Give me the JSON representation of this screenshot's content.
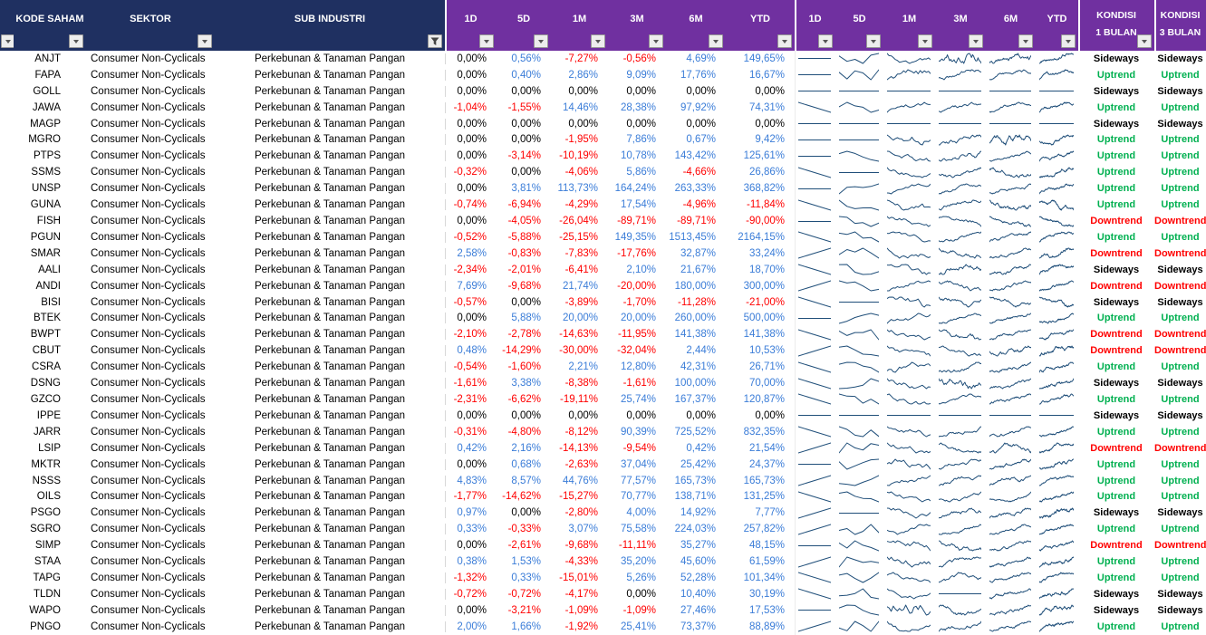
{
  "colors": {
    "header_navy": "#1F3061",
    "header_purple": "#7030A0",
    "positive": "#3B7DD8",
    "negative": "#FF0000",
    "zero": "#000000",
    "uptrend": "#00B050",
    "downtrend": "#FF0000",
    "sideways": "#000000",
    "sparkline": "#1F4E79",
    "filter_button_bg": "#EDEDED"
  },
  "header": {
    "kode_saham": "KODE SAHAM",
    "sektor": "SEKTOR",
    "sub_industri": "SUB INDUSTRI",
    "pct_columns": [
      "1D",
      "5D",
      "1M",
      "3M",
      "6M",
      "YTD"
    ],
    "spark_columns": [
      "1D",
      "5D",
      "1M",
      "3M",
      "6M",
      "YTD"
    ],
    "kondisi_1": {
      "line1": "KONDISI",
      "line2": "1 BULAN"
    },
    "kondisi_2": {
      "line1": "KONDISI",
      "line2": "3 BULAN"
    }
  },
  "rows": [
    {
      "code": "ANJT",
      "sector": "Consumer Non-Cyclicals",
      "sub_industry": "Perkebunan & Tanaman Pangan",
      "returns": [
        "0,00%",
        "0,56%",
        "-7,27%",
        "-0,56%",
        "4,69%",
        "149,65%"
      ],
      "kondisi_1_bulan": "Sideways",
      "kondisi_3_bulan": "Sideways"
    },
    {
      "code": "FAPA",
      "sector": "Consumer Non-Cyclicals",
      "sub_industry": "Perkebunan & Tanaman Pangan",
      "returns": [
        "0,00%",
        "0,40%",
        "2,86%",
        "9,09%",
        "17,76%",
        "16,67%"
      ],
      "kondisi_1_bulan": "Uptrend",
      "kondisi_3_bulan": "Uptrend"
    },
    {
      "code": "GOLL",
      "sector": "Consumer Non-Cyclicals",
      "sub_industry": "Perkebunan & Tanaman Pangan",
      "returns": [
        "0,00%",
        "0,00%",
        "0,00%",
        "0,00%",
        "0,00%",
        "0,00%"
      ],
      "kondisi_1_bulan": "Sideways",
      "kondisi_3_bulan": "Sideways"
    },
    {
      "code": "JAWA",
      "sector": "Consumer Non-Cyclicals",
      "sub_industry": "Perkebunan & Tanaman Pangan",
      "returns": [
        "-1,04%",
        "-1,55%",
        "14,46%",
        "28,38%",
        "97,92%",
        "74,31%"
      ],
      "kondisi_1_bulan": "Uptrend",
      "kondisi_3_bulan": "Uptrend"
    },
    {
      "code": "MAGP",
      "sector": "Consumer Non-Cyclicals",
      "sub_industry": "Perkebunan & Tanaman Pangan",
      "returns": [
        "0,00%",
        "0,00%",
        "0,00%",
        "0,00%",
        "0,00%",
        "0,00%"
      ],
      "kondisi_1_bulan": "Sideways",
      "kondisi_3_bulan": "Sideways"
    },
    {
      "code": "MGRO",
      "sector": "Consumer Non-Cyclicals",
      "sub_industry": "Perkebunan & Tanaman Pangan",
      "returns": [
        "0,00%",
        "0,00%",
        "-1,95%",
        "7,86%",
        "0,67%",
        "9,42%"
      ],
      "kondisi_1_bulan": "Uptrend",
      "kondisi_3_bulan": "Uptrend"
    },
    {
      "code": "PTPS",
      "sector": "Consumer Non-Cyclicals",
      "sub_industry": "Perkebunan & Tanaman Pangan",
      "returns": [
        "0,00%",
        "-3,14%",
        "-10,19%",
        "10,78%",
        "143,42%",
        "125,61%"
      ],
      "kondisi_1_bulan": "Uptrend",
      "kondisi_3_bulan": "Uptrend"
    },
    {
      "code": "SSMS",
      "sector": "Consumer Non-Cyclicals",
      "sub_industry": "Perkebunan & Tanaman Pangan",
      "returns": [
        "-0,32%",
        "0,00%",
        "-4,06%",
        "5,86%",
        "-4,66%",
        "26,86%"
      ],
      "kondisi_1_bulan": "Uptrend",
      "kondisi_3_bulan": "Uptrend"
    },
    {
      "code": "UNSP",
      "sector": "Consumer Non-Cyclicals",
      "sub_industry": "Perkebunan & Tanaman Pangan",
      "returns": [
        "0,00%",
        "3,81%",
        "113,73%",
        "164,24%",
        "263,33%",
        "368,82%"
      ],
      "kondisi_1_bulan": "Uptrend",
      "kondisi_3_bulan": "Uptrend"
    },
    {
      "code": "GUNA",
      "sector": "Consumer Non-Cyclicals",
      "sub_industry": "Perkebunan & Tanaman Pangan",
      "returns": [
        "-0,74%",
        "-6,94%",
        "-4,29%",
        "17,54%",
        "-4,96%",
        "-11,84%"
      ],
      "kondisi_1_bulan": "Uptrend",
      "kondisi_3_bulan": "Uptrend"
    },
    {
      "code": "FISH",
      "sector": "Consumer Non-Cyclicals",
      "sub_industry": "Perkebunan & Tanaman Pangan",
      "returns": [
        "0,00%",
        "-4,05%",
        "-26,04%",
        "-89,71%",
        "-89,71%",
        "-90,00%"
      ],
      "kondisi_1_bulan": "Downtrend",
      "kondisi_3_bulan": "Downtrend"
    },
    {
      "code": "PGUN",
      "sector": "Consumer Non-Cyclicals",
      "sub_industry": "Perkebunan & Tanaman Pangan",
      "returns": [
        "-0,52%",
        "-5,88%",
        "-25,15%",
        "149,35%",
        "1513,45%",
        "2164,15%"
      ],
      "kondisi_1_bulan": "Uptrend",
      "kondisi_3_bulan": "Uptrend"
    },
    {
      "code": "SMAR",
      "sector": "Consumer Non-Cyclicals",
      "sub_industry": "Perkebunan & Tanaman Pangan",
      "returns": [
        "2,58%",
        "-0,83%",
        "-7,83%",
        "-17,76%",
        "32,87%",
        "33,24%"
      ],
      "kondisi_1_bulan": "Downtrend",
      "kondisi_3_bulan": "Downtrend"
    },
    {
      "code": "AALI",
      "sector": "Consumer Non-Cyclicals",
      "sub_industry": "Perkebunan & Tanaman Pangan",
      "returns": [
        "-2,34%",
        "-2,01%",
        "-6,41%",
        "2,10%",
        "21,67%",
        "18,70%"
      ],
      "kondisi_1_bulan": "Sideways",
      "kondisi_3_bulan": "Sideways"
    },
    {
      "code": "ANDI",
      "sector": "Consumer Non-Cyclicals",
      "sub_industry": "Perkebunan & Tanaman Pangan",
      "returns": [
        "7,69%",
        "-9,68%",
        "21,74%",
        "-20,00%",
        "180,00%",
        "300,00%"
      ],
      "kondisi_1_bulan": "Downtrend",
      "kondisi_3_bulan": "Downtrend"
    },
    {
      "code": "BISI",
      "sector": "Consumer Non-Cyclicals",
      "sub_industry": "Perkebunan & Tanaman Pangan",
      "returns": [
        "-0,57%",
        "0,00%",
        "-3,89%",
        "-1,70%",
        "-11,28%",
        "-21,00%"
      ],
      "kondisi_1_bulan": "Sideways",
      "kondisi_3_bulan": "Sideways"
    },
    {
      "code": "BTEK",
      "sector": "Consumer Non-Cyclicals",
      "sub_industry": "Perkebunan & Tanaman Pangan",
      "returns": [
        "0,00%",
        "5,88%",
        "20,00%",
        "20,00%",
        "260,00%",
        "500,00%"
      ],
      "kondisi_1_bulan": "Uptrend",
      "kondisi_3_bulan": "Uptrend"
    },
    {
      "code": "BWPT",
      "sector": "Consumer Non-Cyclicals",
      "sub_industry": "Perkebunan & Tanaman Pangan",
      "returns": [
        "-2,10%",
        "-2,78%",
        "-14,63%",
        "-11,95%",
        "141,38%",
        "141,38%"
      ],
      "kondisi_1_bulan": "Downtrend",
      "kondisi_3_bulan": "Downtrend"
    },
    {
      "code": "CBUT",
      "sector": "Consumer Non-Cyclicals",
      "sub_industry": "Perkebunan & Tanaman Pangan",
      "returns": [
        "0,48%",
        "-14,29%",
        "-30,00%",
        "-32,04%",
        "2,44%",
        "10,53%"
      ],
      "kondisi_1_bulan": "Downtrend",
      "kondisi_3_bulan": "Downtrend"
    },
    {
      "code": "CSRA",
      "sector": "Consumer Non-Cyclicals",
      "sub_industry": "Perkebunan & Tanaman Pangan",
      "returns": [
        "-0,54%",
        "-1,60%",
        "2,21%",
        "12,80%",
        "42,31%",
        "26,71%"
      ],
      "kondisi_1_bulan": "Uptrend",
      "kondisi_3_bulan": "Uptrend"
    },
    {
      "code": "DSNG",
      "sector": "Consumer Non-Cyclicals",
      "sub_industry": "Perkebunan & Tanaman Pangan",
      "returns": [
        "-1,61%",
        "3,38%",
        "-8,38%",
        "-1,61%",
        "100,00%",
        "70,00%"
      ],
      "kondisi_1_bulan": "Sideways",
      "kondisi_3_bulan": "Sideways"
    },
    {
      "code": "GZCO",
      "sector": "Consumer Non-Cyclicals",
      "sub_industry": "Perkebunan & Tanaman Pangan",
      "returns": [
        "-2,31%",
        "-6,62%",
        "-19,11%",
        "25,74%",
        "167,37%",
        "120,87%"
      ],
      "kondisi_1_bulan": "Uptrend",
      "kondisi_3_bulan": "Uptrend"
    },
    {
      "code": "IPPE",
      "sector": "Consumer Non-Cyclicals",
      "sub_industry": "Perkebunan & Tanaman Pangan",
      "returns": [
        "0,00%",
        "0,00%",
        "0,00%",
        "0,00%",
        "0,00%",
        "0,00%"
      ],
      "kondisi_1_bulan": "Sideways",
      "kondisi_3_bulan": "Sideways"
    },
    {
      "code": "JARR",
      "sector": "Consumer Non-Cyclicals",
      "sub_industry": "Perkebunan & Tanaman Pangan",
      "returns": [
        "-0,31%",
        "-4,80%",
        "-8,12%",
        "90,39%",
        "725,52%",
        "832,35%"
      ],
      "kondisi_1_bulan": "Uptrend",
      "kondisi_3_bulan": "Uptrend"
    },
    {
      "code": "LSIP",
      "sector": "Consumer Non-Cyclicals",
      "sub_industry": "Perkebunan & Tanaman Pangan",
      "returns": [
        "0,42%",
        "2,16%",
        "-14,13%",
        "-9,54%",
        "0,42%",
        "21,54%"
      ],
      "kondisi_1_bulan": "Downtrend",
      "kondisi_3_bulan": "Downtrend"
    },
    {
      "code": "MKTR",
      "sector": "Consumer Non-Cyclicals",
      "sub_industry": "Perkebunan & Tanaman Pangan",
      "returns": [
        "0,00%",
        "0,68%",
        "-2,63%",
        "37,04%",
        "25,42%",
        "24,37%"
      ],
      "kondisi_1_bulan": "Uptrend",
      "kondisi_3_bulan": "Uptrend"
    },
    {
      "code": "NSSS",
      "sector": "Consumer Non-Cyclicals",
      "sub_industry": "Perkebunan & Tanaman Pangan",
      "returns": [
        "4,83%",
        "8,57%",
        "44,76%",
        "77,57%",
        "165,73%",
        "165,73%"
      ],
      "kondisi_1_bulan": "Uptrend",
      "kondisi_3_bulan": "Uptrend"
    },
    {
      "code": "OILS",
      "sector": "Consumer Non-Cyclicals",
      "sub_industry": "Perkebunan & Tanaman Pangan",
      "returns": [
        "-1,77%",
        "-14,62%",
        "-15,27%",
        "70,77%",
        "138,71%",
        "131,25%"
      ],
      "kondisi_1_bulan": "Uptrend",
      "kondisi_3_bulan": "Uptrend"
    },
    {
      "code": "PSGO",
      "sector": "Consumer Non-Cyclicals",
      "sub_industry": "Perkebunan & Tanaman Pangan",
      "returns": [
        "0,97%",
        "0,00%",
        "-2,80%",
        "4,00%",
        "14,92%",
        "7,77%"
      ],
      "kondisi_1_bulan": "Sideways",
      "kondisi_3_bulan": "Sideways"
    },
    {
      "code": "SGRO",
      "sector": "Consumer Non-Cyclicals",
      "sub_industry": "Perkebunan & Tanaman Pangan",
      "returns": [
        "0,33%",
        "-0,33%",
        "3,07%",
        "75,58%",
        "224,03%",
        "257,82%"
      ],
      "kondisi_1_bulan": "Uptrend",
      "kondisi_3_bulan": "Uptrend"
    },
    {
      "code": "SIMP",
      "sector": "Consumer Non-Cyclicals",
      "sub_industry": "Perkebunan & Tanaman Pangan",
      "returns": [
        "0,00%",
        "-2,61%",
        "-9,68%",
        "-11,11%",
        "35,27%",
        "48,15%"
      ],
      "kondisi_1_bulan": "Downtrend",
      "kondisi_3_bulan": "Downtrend"
    },
    {
      "code": "STAA",
      "sector": "Consumer Non-Cyclicals",
      "sub_industry": "Perkebunan & Tanaman Pangan",
      "returns": [
        "0,38%",
        "1,53%",
        "-4,33%",
        "35,20%",
        "45,60%",
        "61,59%"
      ],
      "kondisi_1_bulan": "Uptrend",
      "kondisi_3_bulan": "Uptrend"
    },
    {
      "code": "TAPG",
      "sector": "Consumer Non-Cyclicals",
      "sub_industry": "Perkebunan & Tanaman Pangan",
      "returns": [
        "-1,32%",
        "0,33%",
        "-15,01%",
        "5,26%",
        "52,28%",
        "101,34%"
      ],
      "kondisi_1_bulan": "Uptrend",
      "kondisi_3_bulan": "Uptrend"
    },
    {
      "code": "TLDN",
      "sector": "Consumer Non-Cyclicals",
      "sub_industry": "Perkebunan & Tanaman Pangan",
      "returns": [
        "-0,72%",
        "-0,72%",
        "-4,17%",
        "0,00%",
        "10,40%",
        "30,19%"
      ],
      "kondisi_1_bulan": "Sideways",
      "kondisi_3_bulan": "Sideways"
    },
    {
      "code": "WAPO",
      "sector": "Consumer Non-Cyclicals",
      "sub_industry": "Perkebunan & Tanaman Pangan",
      "returns": [
        "0,00%",
        "-3,21%",
        "-1,09%",
        "-1,09%",
        "27,46%",
        "17,53%"
      ],
      "kondisi_1_bulan": "Sideways",
      "kondisi_3_bulan": "Sideways"
    },
    {
      "code": "PNGO",
      "sector": "Consumer Non-Cyclicals",
      "sub_industry": "Perkebunan & Tanaman Pangan",
      "returns": [
        "2,00%",
        "1,66%",
        "-1,92%",
        "25,41%",
        "73,37%",
        "88,89%"
      ],
      "kondisi_1_bulan": "Uptrend",
      "kondisi_3_bulan": "Uptrend"
    }
  ]
}
